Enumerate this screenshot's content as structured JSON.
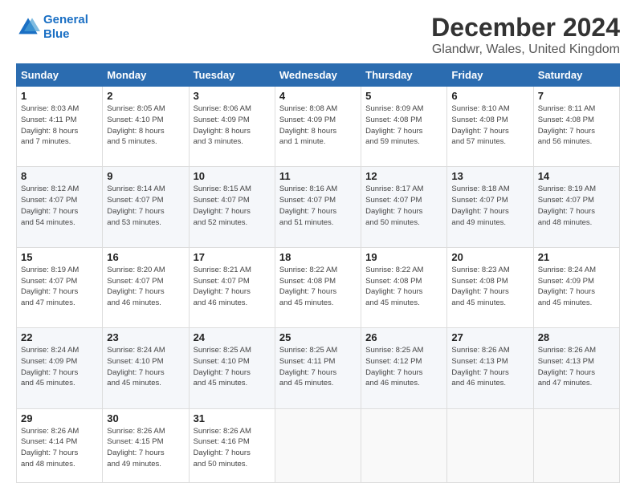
{
  "logo": {
    "line1": "General",
    "line2": "Blue"
  },
  "title": "December 2024",
  "subtitle": "Glandwr, Wales, United Kingdom",
  "headers": [
    "Sunday",
    "Monday",
    "Tuesday",
    "Wednesday",
    "Thursday",
    "Friday",
    "Saturday"
  ],
  "weeks": [
    [
      {
        "day": "1",
        "sunrise": "8:03 AM",
        "sunset": "4:11 PM",
        "daylight": "8 hours and 7 minutes."
      },
      {
        "day": "2",
        "sunrise": "8:05 AM",
        "sunset": "4:10 PM",
        "daylight": "8 hours and 5 minutes."
      },
      {
        "day": "3",
        "sunrise": "8:06 AM",
        "sunset": "4:09 PM",
        "daylight": "8 hours and 3 minutes."
      },
      {
        "day": "4",
        "sunrise": "8:08 AM",
        "sunset": "4:09 PM",
        "daylight": "8 hours and 1 minute."
      },
      {
        "day": "5",
        "sunrise": "8:09 AM",
        "sunset": "4:08 PM",
        "daylight": "7 hours and 59 minutes."
      },
      {
        "day": "6",
        "sunrise": "8:10 AM",
        "sunset": "4:08 PM",
        "daylight": "7 hours and 57 minutes."
      },
      {
        "day": "7",
        "sunrise": "8:11 AM",
        "sunset": "4:08 PM",
        "daylight": "7 hours and 56 minutes."
      }
    ],
    [
      {
        "day": "8",
        "sunrise": "8:12 AM",
        "sunset": "4:07 PM",
        "daylight": "7 hours and 54 minutes."
      },
      {
        "day": "9",
        "sunrise": "8:14 AM",
        "sunset": "4:07 PM",
        "daylight": "7 hours and 53 minutes."
      },
      {
        "day": "10",
        "sunrise": "8:15 AM",
        "sunset": "4:07 PM",
        "daylight": "7 hours and 52 minutes."
      },
      {
        "day": "11",
        "sunrise": "8:16 AM",
        "sunset": "4:07 PM",
        "daylight": "7 hours and 51 minutes."
      },
      {
        "day": "12",
        "sunrise": "8:17 AM",
        "sunset": "4:07 PM",
        "daylight": "7 hours and 50 minutes."
      },
      {
        "day": "13",
        "sunrise": "8:18 AM",
        "sunset": "4:07 PM",
        "daylight": "7 hours and 49 minutes."
      },
      {
        "day": "14",
        "sunrise": "8:19 AM",
        "sunset": "4:07 PM",
        "daylight": "7 hours and 48 minutes."
      }
    ],
    [
      {
        "day": "15",
        "sunrise": "8:19 AM",
        "sunset": "4:07 PM",
        "daylight": "7 hours and 47 minutes."
      },
      {
        "day": "16",
        "sunrise": "8:20 AM",
        "sunset": "4:07 PM",
        "daylight": "7 hours and 46 minutes."
      },
      {
        "day": "17",
        "sunrise": "8:21 AM",
        "sunset": "4:07 PM",
        "daylight": "7 hours and 46 minutes."
      },
      {
        "day": "18",
        "sunrise": "8:22 AM",
        "sunset": "4:08 PM",
        "daylight": "7 hours and 45 minutes."
      },
      {
        "day": "19",
        "sunrise": "8:22 AM",
        "sunset": "4:08 PM",
        "daylight": "7 hours and 45 minutes."
      },
      {
        "day": "20",
        "sunrise": "8:23 AM",
        "sunset": "4:08 PM",
        "daylight": "7 hours and 45 minutes."
      },
      {
        "day": "21",
        "sunrise": "8:24 AM",
        "sunset": "4:09 PM",
        "daylight": "7 hours and 45 minutes."
      }
    ],
    [
      {
        "day": "22",
        "sunrise": "8:24 AM",
        "sunset": "4:09 PM",
        "daylight": "7 hours and 45 minutes."
      },
      {
        "day": "23",
        "sunrise": "8:24 AM",
        "sunset": "4:10 PM",
        "daylight": "7 hours and 45 minutes."
      },
      {
        "day": "24",
        "sunrise": "8:25 AM",
        "sunset": "4:10 PM",
        "daylight": "7 hours and 45 minutes."
      },
      {
        "day": "25",
        "sunrise": "8:25 AM",
        "sunset": "4:11 PM",
        "daylight": "7 hours and 45 minutes."
      },
      {
        "day": "26",
        "sunrise": "8:25 AM",
        "sunset": "4:12 PM",
        "daylight": "7 hours and 46 minutes."
      },
      {
        "day": "27",
        "sunrise": "8:26 AM",
        "sunset": "4:13 PM",
        "daylight": "7 hours and 46 minutes."
      },
      {
        "day": "28",
        "sunrise": "8:26 AM",
        "sunset": "4:13 PM",
        "daylight": "7 hours and 47 minutes."
      }
    ],
    [
      {
        "day": "29",
        "sunrise": "8:26 AM",
        "sunset": "4:14 PM",
        "daylight": "7 hours and 48 minutes."
      },
      {
        "day": "30",
        "sunrise": "8:26 AM",
        "sunset": "4:15 PM",
        "daylight": "7 hours and 49 minutes."
      },
      {
        "day": "31",
        "sunrise": "8:26 AM",
        "sunset": "4:16 PM",
        "daylight": "7 hours and 50 minutes."
      },
      null,
      null,
      null,
      null
    ]
  ]
}
